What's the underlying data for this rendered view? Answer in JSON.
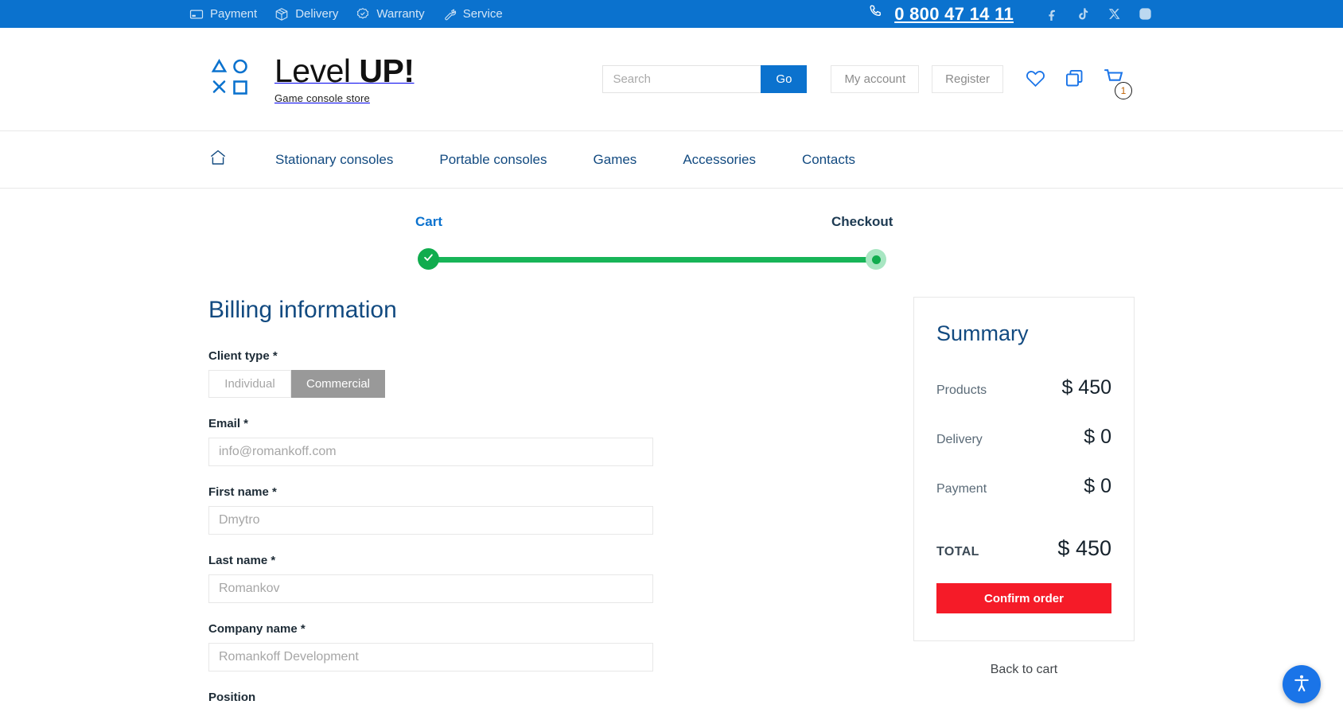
{
  "topbar": {
    "links": [
      {
        "label": "Payment",
        "icon": "card-icon"
      },
      {
        "label": "Delivery",
        "icon": "box-icon"
      },
      {
        "label": "Warranty",
        "icon": "badge-check-icon"
      },
      {
        "label": "Service",
        "icon": "wrench-icon"
      }
    ],
    "phone": "0 800 47 14 11",
    "phone_icon": "phone-icon",
    "socials": [
      "facebook-icon",
      "tiktok-icon",
      "x-twitter-icon",
      "instagram-icon"
    ],
    "bg_color": "#0b72ce"
  },
  "header": {
    "brand_name_thin": "Level ",
    "brand_name_bold": "UP!",
    "brand_tagline": "Game console store",
    "logo_icon": "playstation-shapes-logo",
    "search": {
      "placeholder": "Search",
      "value": "",
      "go_label": "Go"
    },
    "account_label": "My account",
    "register_label": "Register",
    "wishlist_icon": "heart-icon",
    "compare_icon": "compare-squares-icon",
    "cart_icon": "cart-icon",
    "cart_count": "1"
  },
  "nav": {
    "home_icon": "home-icon",
    "items": [
      {
        "label": "Stationary consoles"
      },
      {
        "label": "Portable consoles"
      },
      {
        "label": "Games"
      },
      {
        "label": "Accessories"
      },
      {
        "label": "Contacts"
      }
    ]
  },
  "stepper": {
    "steps": [
      {
        "label": "Cart",
        "state": "completed",
        "icon": "check-icon"
      },
      {
        "label": "Checkout",
        "state": "current",
        "icon": "dot-icon"
      }
    ],
    "line_color": "#18b558"
  },
  "billing": {
    "title": "Billing information",
    "client_type": {
      "label": "Client type *",
      "options": [
        "Individual",
        "Commercial"
      ],
      "selected": "Commercial"
    },
    "fields": [
      {
        "label": "Email *",
        "placeholder": "info@romankoff.com",
        "value": "",
        "name": "email-field"
      },
      {
        "label": "First name *",
        "placeholder": "Dmytro",
        "value": "",
        "name": "first-name-field"
      },
      {
        "label": "Last name *",
        "placeholder": "Romankov",
        "value": "",
        "name": "last-name-field"
      },
      {
        "label": "Company name *",
        "placeholder": "Romankoff Development",
        "value": "",
        "name": "company-name-field"
      },
      {
        "label": "Position",
        "placeholder": "",
        "value": "",
        "name": "position-field"
      }
    ]
  },
  "summary": {
    "title": "Summary",
    "rows": [
      {
        "key": "Products",
        "value": "$ 450"
      },
      {
        "key": "Delivery",
        "value": "$ 0"
      },
      {
        "key": "Payment",
        "value": "$ 0"
      }
    ],
    "total_key": "TOTAL",
    "total_value": "$ 450",
    "confirm_label": "Confirm order",
    "back_label": "Back to cart",
    "confirm_color": "#f51b28"
  },
  "accessibility": {
    "fab_icon": "accessibility-icon",
    "fab_color": "#1a74e8"
  }
}
